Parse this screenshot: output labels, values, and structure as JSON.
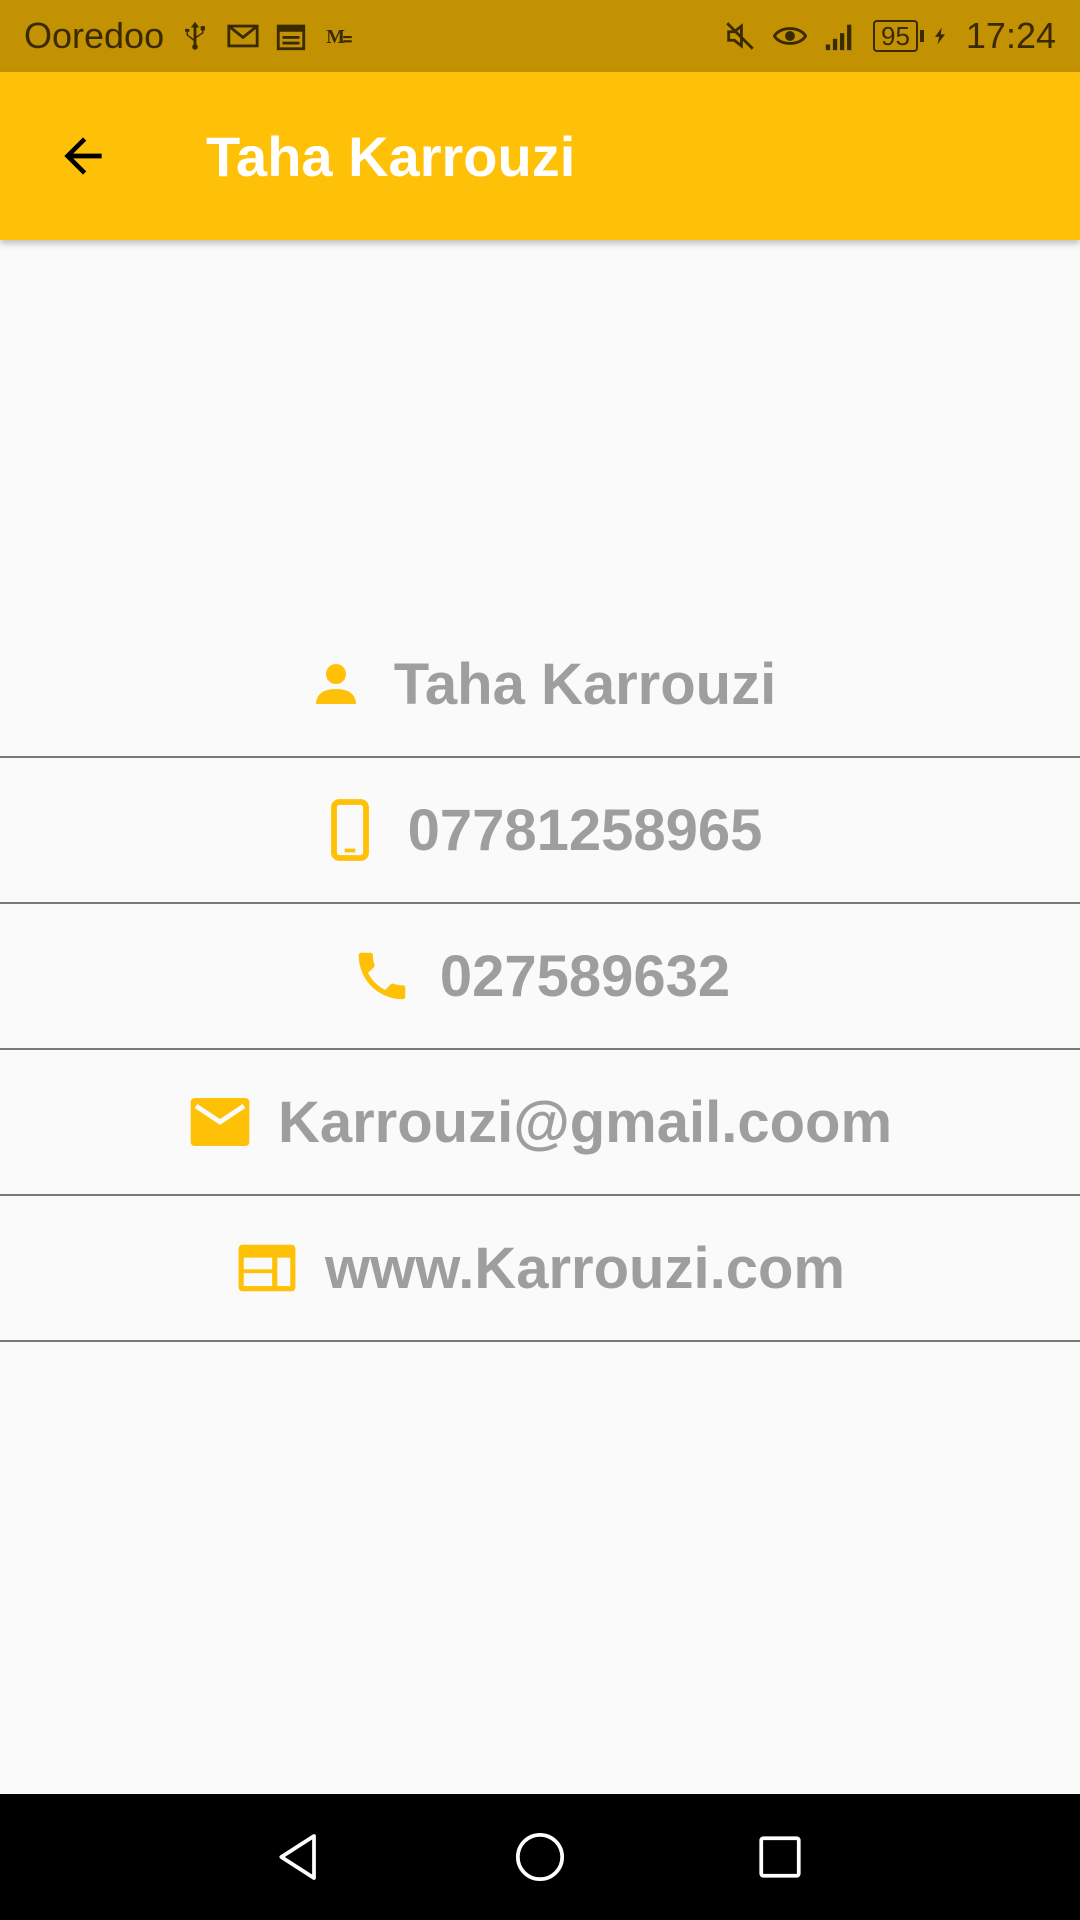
{
  "status_bar": {
    "carrier": "Ooredoo",
    "battery": "95",
    "time": "17:24",
    "icons_left": [
      "usb-icon",
      "gmail-icon",
      "calendar-icon",
      "mail-m-icon"
    ],
    "icons_right": [
      "mute-icon",
      "eye-icon",
      "signal-icon",
      "battery-icon",
      "charging-icon"
    ]
  },
  "app_bar": {
    "title": "Taha Karrouzi",
    "background": "#ffc107"
  },
  "details": {
    "name": "Taha Karrouzi",
    "mobile": "07781258965",
    "phone": "027589632",
    "email": "Karrouzi@gmail.coom",
    "website": "www.Karrouzi.com",
    "icon_color": "#ffc107",
    "text_color": "#9e9e9e"
  },
  "nav_bar": {
    "buttons": [
      "back-nav-icon",
      "home-nav-icon",
      "recents-nav-icon"
    ]
  }
}
